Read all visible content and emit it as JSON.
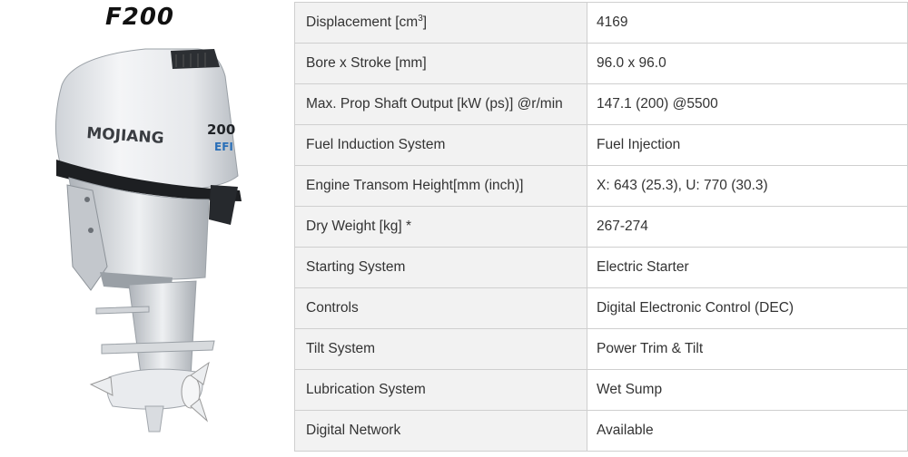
{
  "product": {
    "model": "F200",
    "brand_logo": "MOJIANG",
    "cowl_power": "200",
    "cowl_badge": "EFI"
  },
  "specs": [
    {
      "label": "Displacement [cm",
      "label_sup": "3",
      "label_suffix": "]",
      "value": "4169"
    },
    {
      "label": "Bore x Stroke [mm]",
      "value": "96.0 x 96.0"
    },
    {
      "label": "Max. Prop Shaft Output [kW (ps)] @r/min",
      "value": "147.1 (200) @5500"
    },
    {
      "label": "Fuel Induction System",
      "value": "Fuel Injection"
    },
    {
      "label": "Engine Transom Height[mm (inch)]",
      "value": "X: 643 (25.3), U: 770 (30.3)"
    },
    {
      "label": "Dry Weight [kg] *",
      "value": "267-274"
    },
    {
      "label": "Starting System",
      "value": "Electric Starter"
    },
    {
      "label": "Controls",
      "value": "Digital Electronic Control (DEC)"
    },
    {
      "label": "Tilt System",
      "value": "Power Trim & Tilt"
    },
    {
      "label": "Lubrication System",
      "value": "Wet Sump"
    },
    {
      "label": "Digital Network",
      "value": "Available"
    }
  ],
  "colors": {
    "label_bg": "#f2f2f2",
    "border": "#cfcfcf",
    "text": "#333333",
    "badge_blue": "#2a6fb8"
  }
}
